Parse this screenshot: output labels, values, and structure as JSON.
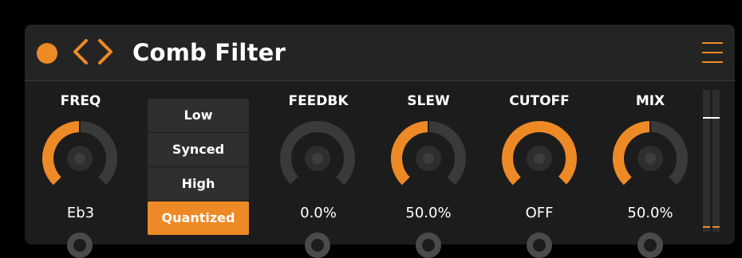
{
  "header": {
    "title": "Comb Filter",
    "accent": "#ee8a25",
    "icons": [
      "device-on-dot-icon",
      "chevron-left-icon",
      "chevron-right-icon",
      "hamburger-menu-icon"
    ]
  },
  "controls": {
    "freq": {
      "label": "FREQ",
      "value": "Eb3",
      "level": 0.5
    },
    "mode": {
      "options": [
        "Low",
        "Synced",
        "High",
        "Quantized"
      ],
      "selected": "Quantized"
    },
    "feedbk": {
      "label": "FEEDBK",
      "value": "0.0%",
      "level": 0.0
    },
    "slew": {
      "label": "SLEW",
      "value": "50.0%",
      "level": 0.5
    },
    "cutoff": {
      "label": "CUTOFF",
      "value": "OFF",
      "level": 1.0
    },
    "mix": {
      "label": "MIX",
      "value": "50.0%",
      "level": 0.5
    }
  },
  "colors": {
    "panel": "#1c1c1c",
    "header": "#242424",
    "track": "#3a3a3a",
    "accent": "#ee8a25"
  }
}
